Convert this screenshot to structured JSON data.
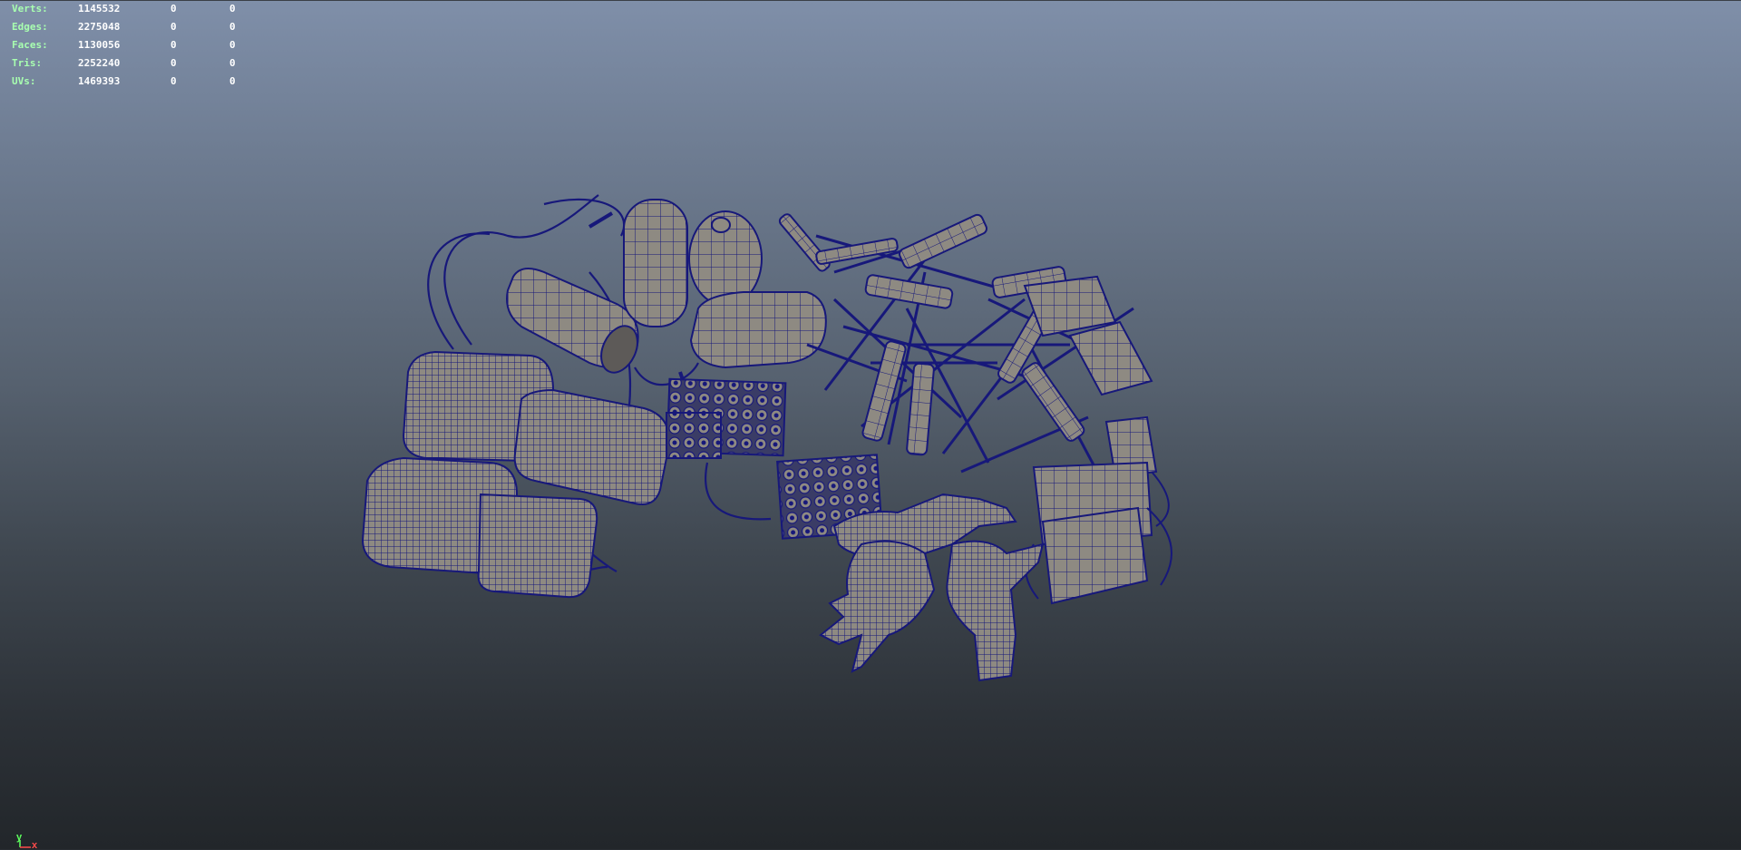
{
  "stats": [
    {
      "label": "Verts:",
      "total": "1145532",
      "selected": "0",
      "component": "0"
    },
    {
      "label": "Edges:",
      "total": "2275048",
      "selected": "0",
      "component": "0"
    },
    {
      "label": "Faces:",
      "total": "1130056",
      "selected": "0",
      "component": "0"
    },
    {
      "label": "Tris:",
      "total": "2252240",
      "selected": "0",
      "component": "0"
    },
    {
      "label": "UVs:",
      "total": "1469393",
      "selected": "0",
      "component": "0"
    }
  ],
  "axis": {
    "y_label": "y",
    "x_label": "x"
  },
  "colors": {
    "wire": "#17187a",
    "mesh_fill": "#8e8a82",
    "hud_label": "#a8ffb0"
  },
  "scene_objects": [
    "iv-bag-icon",
    "bottle-icon",
    "syringe-icon",
    "needle-pile-icon",
    "tablet-blister-icon",
    "glove-icon",
    "face-mask-icon",
    "tube-icon"
  ]
}
